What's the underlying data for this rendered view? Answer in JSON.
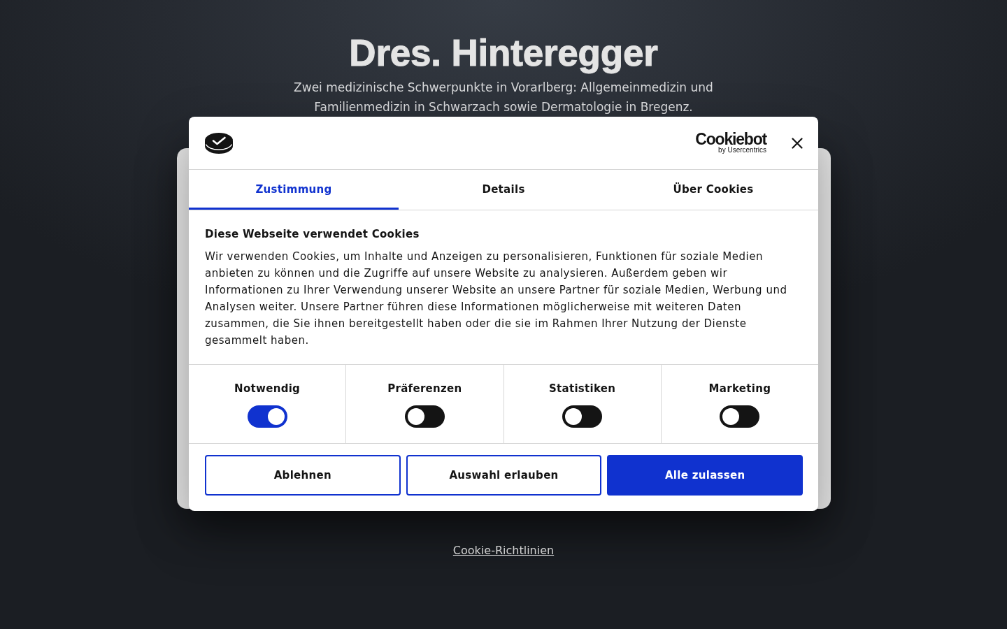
{
  "page": {
    "title": "Dres. Hinteregger",
    "subtitle": "Zwei medizinische Schwerpunkte in Vorarlberg: Allgemeinmedizin und Familienmedizin in Schwarzach sowie Dermatologie in Bregenz.",
    "link": "Cookie-Richtlinien"
  },
  "consent_dialog": {
    "brand": {
      "name": "Cookiebot",
      "tagline": "by Usercentrics"
    },
    "tabs": [
      {
        "label": "Zustimmung",
        "selected": true
      },
      {
        "label": "Details",
        "selected": false
      },
      {
        "label": "Über Cookies",
        "selected": false
      }
    ],
    "heading": "Diese Webseite verwendet Cookies",
    "text": "Wir verwenden Cookies, um Inhalte und Anzeigen zu personalisieren, Funktionen für soziale Medien anbieten zu können und die Zugriffe auf unsere Website zu analysieren. Außerdem geben wir Informationen zu Ihrer Verwendung unserer Website an unsere Partner für soziale Medien, Werbung und Analysen weiter. Unsere Partner führen diese Informationen möglicherweise mit weiteren Daten zusammen, die Sie ihnen bereitgestellt haben oder die sie im Rahmen Ihrer Nutzung der Dienste gesammelt haben.",
    "categories": [
      {
        "label": "Notwendig",
        "checked": true
      },
      {
        "label": "Präferenzen",
        "checked": false
      },
      {
        "label": "Statistiken",
        "checked": false
      },
      {
        "label": "Marketing",
        "checked": false
      }
    ],
    "buttons": [
      {
        "label": "Ablehnen",
        "kind": "outline"
      },
      {
        "label": "Auswahl erlauben",
        "kind": "outline"
      },
      {
        "label": "Alle zulassen",
        "kind": "primary"
      }
    ]
  }
}
